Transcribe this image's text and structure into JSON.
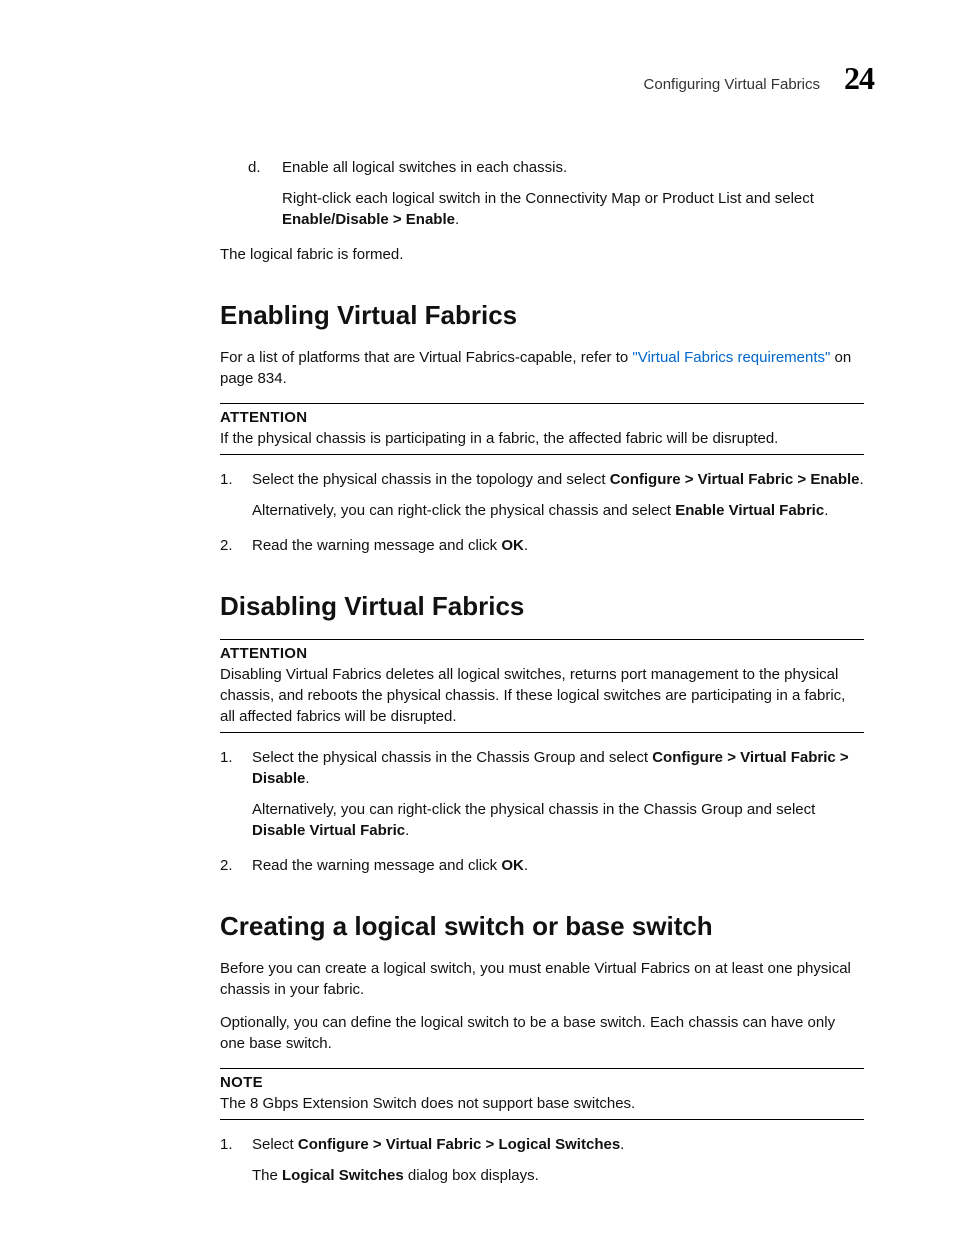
{
  "header": {
    "title": "Configuring Virtual Fabrics",
    "chapter": "24"
  },
  "intro": {
    "step_d_marker": "d.",
    "step_d_text": "Enable all logical switches in each chassis.",
    "step_d_sub_pre": "Right-click each logical switch in the Connectivity Map or Product List and select ",
    "step_d_sub_bold": "Enable/Disable > Enable",
    "step_d_sub_post": ".",
    "closing": "The logical fabric is formed."
  },
  "s1": {
    "heading": "Enabling Virtual Fabrics",
    "para_pre": "For a list of platforms that are Virtual Fabrics-capable, refer to ",
    "para_link": "\"Virtual Fabrics requirements\"",
    "para_post": " on page 834.",
    "att_label": "ATTENTION",
    "att_body": "If the physical chassis is participating in a fabric, the affected fabric will be disrupted.",
    "step1_marker": "1.",
    "step1_a": "Select the physical chassis in the topology and select ",
    "step1_b": "Configure > Virtual Fabric > Enable",
    "step1_c": ".",
    "step1_alt_a": "Alternatively, you can right-click the physical chassis and select ",
    "step1_alt_b": "Enable Virtual Fabric",
    "step1_alt_c": ".",
    "step2_marker": "2.",
    "step2_a": "Read the warning message and click ",
    "step2_b": "OK",
    "step2_c": "."
  },
  "s2": {
    "heading": "Disabling Virtual Fabrics",
    "att_label": "ATTENTION",
    "att_body": "Disabling Virtual Fabrics deletes all logical switches, returns port management to the physical chassis, and reboots the physical chassis. If these logical switches are participating in a fabric, all affected fabrics will be disrupted.",
    "step1_marker": "1.",
    "step1_a": "Select the physical chassis in the Chassis Group and select ",
    "step1_b": "Configure > Virtual Fabric > Disable",
    "step1_c": ".",
    "step1_alt_a": "Alternatively, you can right-click the physical chassis in the Chassis Group and select ",
    "step1_alt_b": "Disable Virtual Fabric",
    "step1_alt_c": ".",
    "step2_marker": "2.",
    "step2_a": "Read the warning message and click ",
    "step2_b": "OK",
    "step2_c": "."
  },
  "s3": {
    "heading": "Creating a logical switch or base switch",
    "p1": "Before you can create a logical switch, you must enable Virtual Fabrics on at least one physical chassis in your fabric.",
    "p2": "Optionally, you can define the logical switch to be a base switch. Each chassis can have only one base switch.",
    "note_label": "NOTE",
    "note_body": "The 8 Gbps Extension Switch does not support base switches.",
    "step1_marker": "1.",
    "step1_a": "Select ",
    "step1_b": "Configure > Virtual Fabric > Logical Switches",
    "step1_c": ".",
    "step1_alt_a": "The ",
    "step1_alt_b": "Logical Switches",
    "step1_alt_c": " dialog box displays."
  }
}
